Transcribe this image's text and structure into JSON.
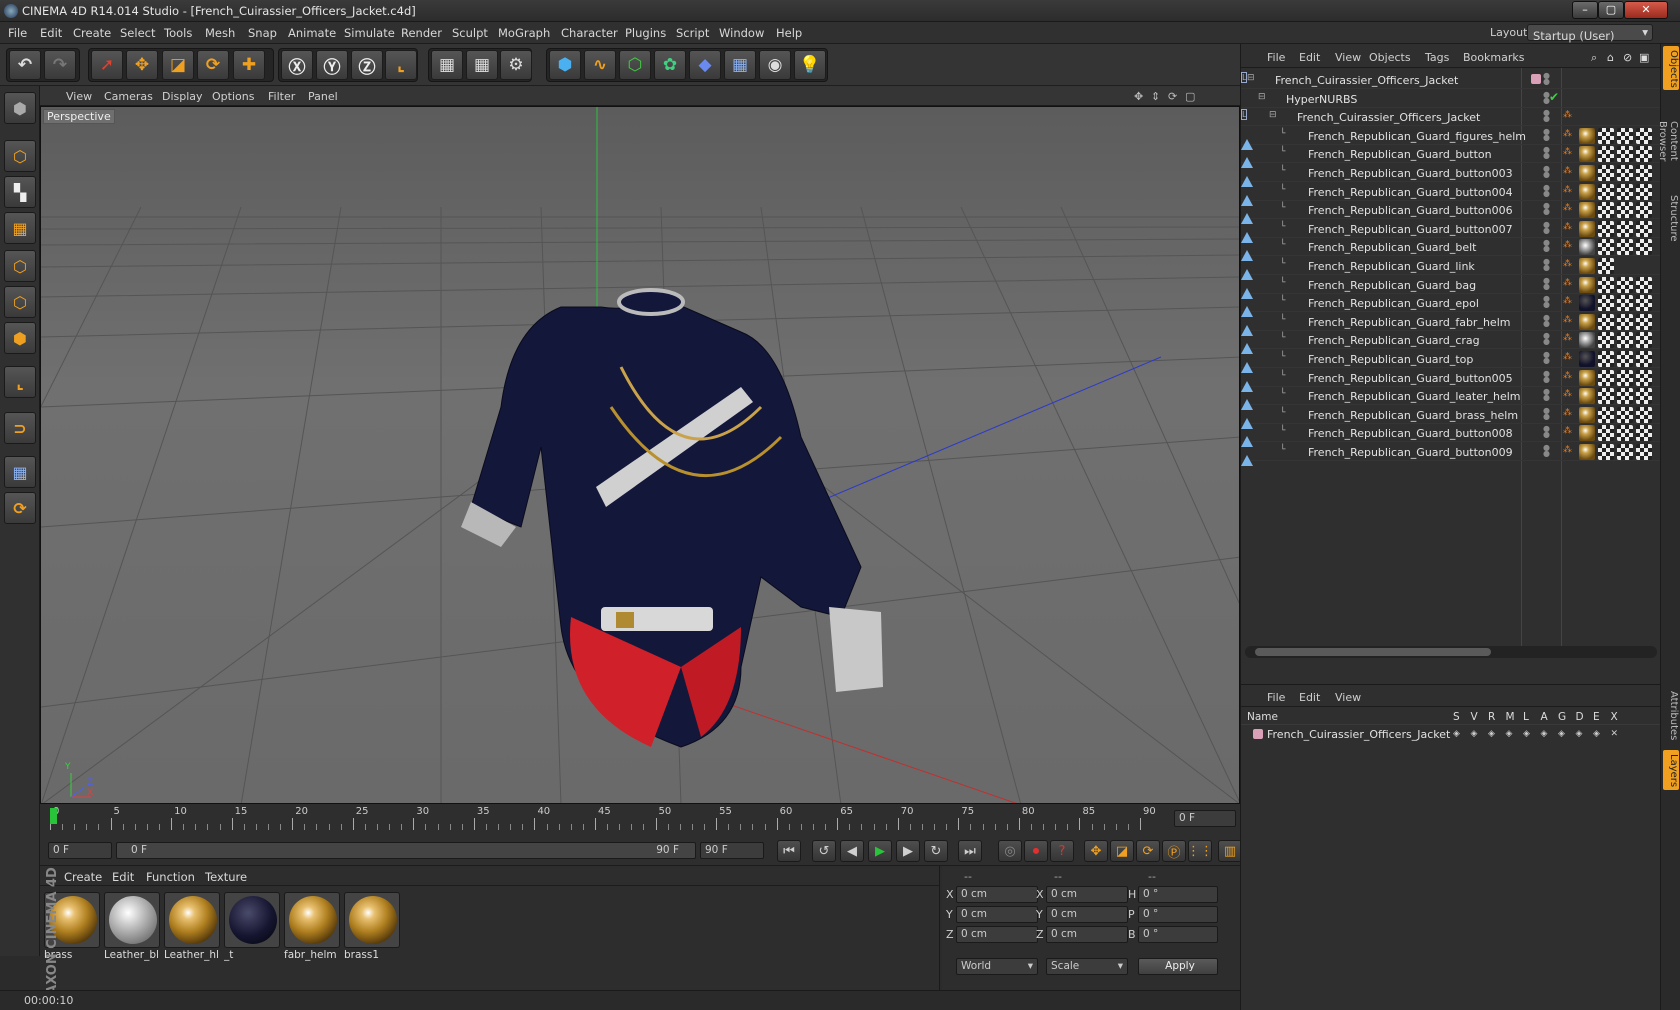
{
  "window": {
    "title": "CINEMA 4D R14.014 Studio - [French_Cuirassier_Officers_Jacket.c4d]"
  },
  "menu": [
    "File",
    "Edit",
    "Create",
    "Select",
    "Tools",
    "Mesh",
    "Snap",
    "Animate",
    "Simulate",
    "Render",
    "Sculpt",
    "MoGraph",
    "Character",
    "Plugins",
    "Script",
    "Window",
    "Help"
  ],
  "layout": {
    "label": "Layout:",
    "value": "Startup (User)"
  },
  "viewport": {
    "menu": [
      "View",
      "Cameras",
      "Display",
      "Options",
      "Filter",
      "Panel"
    ],
    "label": "Perspective",
    "axis_labels": {
      "x": "X",
      "y": "Y",
      "z": "Z"
    }
  },
  "timeline": {
    "ticks": [
      "0",
      "5",
      "10",
      "15",
      "20",
      "25",
      "30",
      "35",
      "40",
      "45",
      "50",
      "55",
      "60",
      "65",
      "70",
      "75",
      "80",
      "85",
      "90"
    ],
    "current_frame": "0 F",
    "start_field": "0 F",
    "range_start": "0 F",
    "range_end": "90 F",
    "end_field": "90 F"
  },
  "materials": {
    "menu": [
      "Create",
      "Edit",
      "Function",
      "Texture"
    ],
    "items": [
      {
        "name": "brass",
        "kind": "brass"
      },
      {
        "name": "Leather_bl",
        "kind": "leather"
      },
      {
        "name": "Leather_hl",
        "kind": "brass"
      },
      {
        "name": "_t",
        "kind": "dark"
      },
      {
        "name": "fabr_helm",
        "kind": "brass"
      },
      {
        "name": "brass1",
        "kind": "brass"
      }
    ]
  },
  "coords": {
    "header": [
      "--",
      "--",
      "--"
    ],
    "rows": [
      {
        "a": "X",
        "av": "0 cm",
        "b": "X",
        "bv": "0 cm",
        "c": "H",
        "cv": "0 °"
      },
      {
        "a": "Y",
        "av": "0 cm",
        "b": "Y",
        "bv": "0 cm",
        "c": "P",
        "cv": "0 °"
      },
      {
        "a": "Z",
        "av": "0 cm",
        "b": "Z",
        "bv": "0 cm",
        "c": "B",
        "cv": "0 °"
      }
    ],
    "world": "World",
    "scale": "Scale",
    "apply": "Apply"
  },
  "status": {
    "time": "00:00:10"
  },
  "branding": {
    "logo": "MAXON CINEMA 4D"
  },
  "objects": {
    "menu": [
      "File",
      "Edit",
      "View",
      "Objects",
      "Tags",
      "Bookmarks"
    ],
    "rows": [
      {
        "name": "French_Cuirassier_Officers_Jacket",
        "level": 0,
        "icon": "null",
        "tags": []
      },
      {
        "name": "HyperNURBS",
        "level": 1,
        "icon": "nurbs",
        "tags": []
      },
      {
        "name": "French_Cuirassier_Officers_Jacket",
        "level": 2,
        "icon": "null",
        "tags": []
      },
      {
        "name": "French_Republican_Guard_figures_helm",
        "level": 3,
        "icon": "poly",
        "tags": [
          "brass",
          "chk",
          "chk",
          "chk"
        ]
      },
      {
        "name": "French_Republican_Guard_button",
        "level": 3,
        "icon": "poly",
        "tags": [
          "brass",
          "chk",
          "chk",
          "chk"
        ]
      },
      {
        "name": "French_Republican_Guard_button003",
        "level": 3,
        "icon": "poly",
        "tags": [
          "brass",
          "chk",
          "chk",
          "chk"
        ]
      },
      {
        "name": "French_Republican_Guard_button004",
        "level": 3,
        "icon": "poly",
        "tags": [
          "brass",
          "chk",
          "chk",
          "chk"
        ]
      },
      {
        "name": "French_Republican_Guard_button006",
        "level": 3,
        "icon": "poly",
        "tags": [
          "brass",
          "chk",
          "chk",
          "chk"
        ]
      },
      {
        "name": "French_Republican_Guard_button007",
        "level": 3,
        "icon": "poly",
        "tags": [
          "brass",
          "chk",
          "chk",
          "chk"
        ]
      },
      {
        "name": "French_Republican_Guard_belt",
        "level": 3,
        "icon": "poly",
        "tags": [
          "phong",
          "chk",
          "chk",
          "chk"
        ]
      },
      {
        "name": "French_Republican_Guard_link",
        "level": 3,
        "icon": "poly",
        "tags": [
          "brass",
          "chk"
        ]
      },
      {
        "name": "French_Republican_Guard_bag",
        "level": 3,
        "icon": "poly",
        "tags": [
          "brass",
          "chk",
          "chk",
          "chk"
        ]
      },
      {
        "name": "French_Republican_Guard_epol",
        "level": 3,
        "icon": "poly",
        "tags": [
          "dark",
          "chk",
          "chk",
          "chk"
        ]
      },
      {
        "name": "French_Republican_Guard_fabr_helm",
        "level": 3,
        "icon": "poly",
        "tags": [
          "brass",
          "chk",
          "chk",
          "chk"
        ]
      },
      {
        "name": "French_Republican_Guard_crag",
        "level": 3,
        "icon": "poly",
        "tags": [
          "phong",
          "chk",
          "chk",
          "chk"
        ]
      },
      {
        "name": "French_Republican_Guard_top",
        "level": 3,
        "icon": "poly",
        "tags": [
          "dark",
          "chk",
          "chk",
          "chk"
        ]
      },
      {
        "name": "French_Republican_Guard_button005",
        "level": 3,
        "icon": "poly",
        "tags": [
          "brass",
          "chk",
          "chk",
          "chk"
        ]
      },
      {
        "name": "French_Republican_Guard_leater_helm",
        "level": 3,
        "icon": "poly",
        "tags": [
          "brass",
          "chk",
          "chk",
          "chk"
        ]
      },
      {
        "name": "French_Republican_Guard_brass_helm",
        "level": 3,
        "icon": "poly",
        "tags": [
          "brass",
          "chk",
          "chk",
          "chk"
        ]
      },
      {
        "name": "French_Republican_Guard_button008",
        "level": 3,
        "icon": "poly",
        "tags": [
          "brass",
          "chk",
          "chk",
          "chk"
        ]
      },
      {
        "name": "French_Republican_Guard_button009",
        "level": 3,
        "icon": "poly",
        "tags": [
          "brass",
          "chk",
          "chk",
          "chk"
        ]
      }
    ]
  },
  "layers": {
    "menu": [
      "File",
      "Edit",
      "View"
    ],
    "columns": [
      "Name",
      "S",
      "V",
      "R",
      "M",
      "L",
      "A",
      "G",
      "D",
      "E",
      "X"
    ],
    "rows": [
      {
        "name": "French_Cuirassier_Officers_Jacket",
        "color": "#d9a0b8"
      }
    ]
  },
  "side_tabs": [
    "Objects",
    "Content Browser",
    "Structure",
    "Attributes",
    "Layers"
  ],
  "colors": {
    "accent": "#f0a020",
    "selection": "#3a5a8a",
    "play": "#29c43a"
  }
}
